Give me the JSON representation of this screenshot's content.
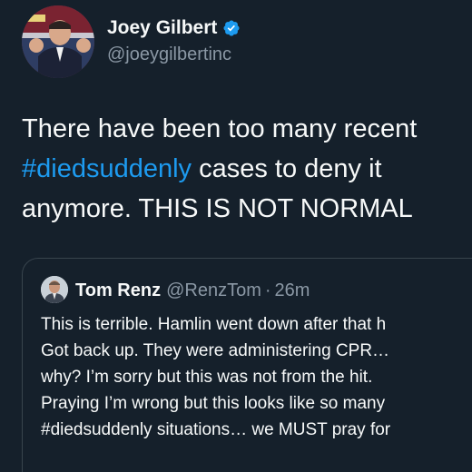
{
  "author": {
    "display_name": "Joey Gilbert",
    "handle": "@joeygilbertinc",
    "avatar_icon": "profile-photo-icon",
    "verified_icon": "verified-badge-icon"
  },
  "tweet": {
    "line1": "There have been too many recent",
    "line2_hashtag": "#diedsuddenly",
    "line2_rest": " cases to deny it",
    "line3": "anymore. THIS IS NOT NORMAL"
  },
  "quoted_tweet": {
    "display_name": "Tom Renz",
    "handle": "@RenzTom",
    "separator": "·",
    "time": "26m",
    "avatar_icon": "profile-photo-icon",
    "lines": [
      "This is terrible. Hamlin went down after that h",
      "Got back up. They were administering CPR…",
      "why? I’m sorry but this was not from the hit.",
      "Praying I’m wrong but this looks like so many",
      "#diedsuddenly situations… we MUST pray for"
    ]
  },
  "colors": {
    "background": "#15202b",
    "text": "#f7f9f9",
    "secondary_text": "#8b98a5",
    "link": "#1d9bf0",
    "verified": "#1d9bf0",
    "border": "#38444d"
  }
}
